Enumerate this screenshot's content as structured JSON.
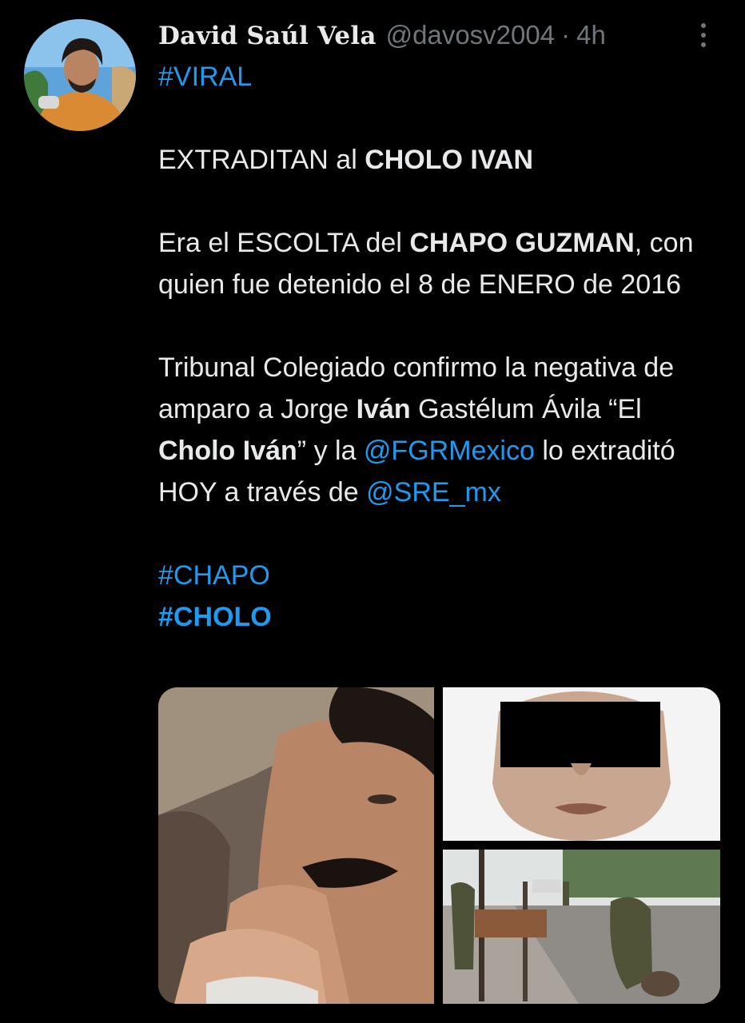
{
  "author": {
    "display_name": "David Saúl Vela",
    "handle": "@davosv2004",
    "separator": "·",
    "time": "4h"
  },
  "tweet": {
    "hashtag_top": "#VIRAL",
    "line1_a": "EXTRADITAN al ",
    "line1_b": "CHOLO IVAN",
    "p2_a": "Era el ESCOLTA del ",
    "p2_b": "CHAPO GUZMAN",
    "p2_c": ", con quien fue detenido el 8 de ENERO de 2016",
    "p3_a": "Tribunal Colegiado confirmo la negativa de amparo a Jorge ",
    "p3_b": "Iván",
    "p3_c": " Gastélum Ávila “El ",
    "p3_d": "Cholo Iván",
    "p3_e": "” y la ",
    "p3_mention1": "@FGRMexico",
    "p3_f": " lo extraditó HOY a través de ",
    "p3_mention2": "@SRE_mx",
    "hashtag1": "#CHAPO",
    "hashtag2": "#CHOLO"
  },
  "icons": {
    "more": "more-vertical-icon"
  },
  "colors": {
    "background": "#000000",
    "text": "#e7e9ea",
    "secondary": "#71767b",
    "link": "#1d9bf0"
  }
}
